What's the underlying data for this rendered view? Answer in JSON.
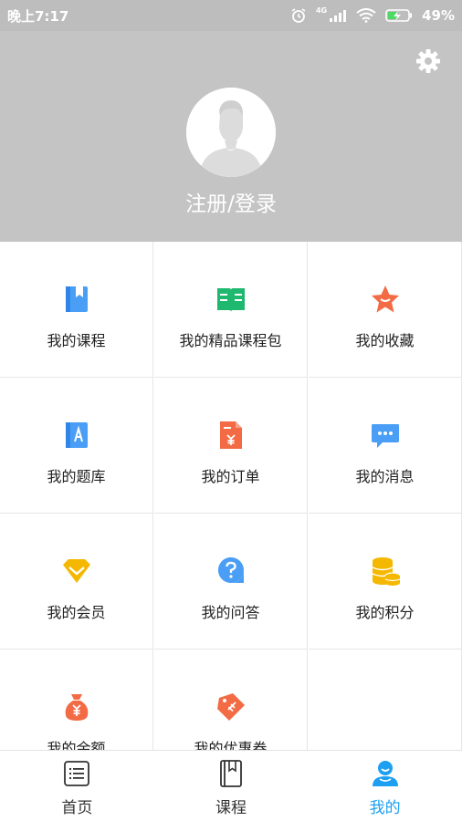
{
  "status_bar": {
    "time": "晚上7:17",
    "network": "4G",
    "battery": "49%"
  },
  "header": {
    "login_text": "注册/登录",
    "settings_icon": "gear-icon",
    "background": "#c4c4c4"
  },
  "grid": {
    "items": [
      {
        "label": "我的课程",
        "icon": "book-icon",
        "color": "#4a9ef5"
      },
      {
        "label": "我的精品课程包",
        "icon": "open-book-icon",
        "color": "#1fb86f"
      },
      {
        "label": "我的收藏",
        "icon": "star-icon",
        "color": "#f36b45"
      },
      {
        "label": "我的题库",
        "icon": "question-bank-icon",
        "color": "#4a9ef5"
      },
      {
        "label": "我的订单",
        "icon": "order-icon",
        "color": "#f36b45"
      },
      {
        "label": "我的消息",
        "icon": "message-icon",
        "color": "#4a9ef5"
      },
      {
        "label": "我的会员",
        "icon": "vip-icon",
        "color": "#f5b800"
      },
      {
        "label": "我的问答",
        "icon": "question-icon",
        "color": "#4a9ef5"
      },
      {
        "label": "我的积分",
        "icon": "coins-icon",
        "color": "#f5b800"
      },
      {
        "label": "我的余额",
        "icon": "money-bag-icon",
        "color": "#f36b45"
      },
      {
        "label": "我的优惠券",
        "icon": "coupon-icon",
        "color": "#f36b45"
      }
    ]
  },
  "tabbar": {
    "tabs": [
      {
        "label": "首页",
        "icon": "list-icon",
        "active": false
      },
      {
        "label": "课程",
        "icon": "bookmark-book-icon",
        "active": false
      },
      {
        "label": "我的",
        "icon": "user-icon",
        "active": true
      }
    ],
    "active_color": "#1ea0f2"
  }
}
